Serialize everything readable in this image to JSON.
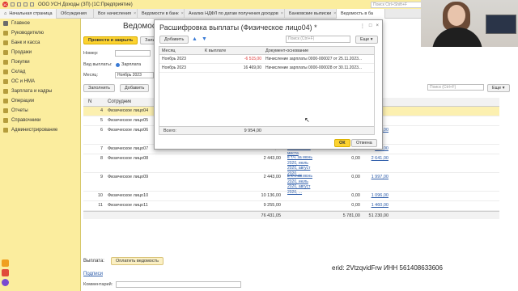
{
  "app": {
    "title": "ООО УСН Доходы (ЗП)  (1С:Предприятие)",
    "search_placeholder": "Поиск Ctrl+Shift+F"
  },
  "tabs": [
    {
      "label": "Начальная страница"
    },
    {
      "label": "Обсуждения"
    },
    {
      "label": "Все начисления"
    },
    {
      "label": "Ведомости в банк"
    },
    {
      "label": "Анализ НДФЛ по датам получения доходов"
    },
    {
      "label": "Банковские выписки"
    },
    {
      "label": "Ведомость в ба"
    }
  ],
  "sidebar": [
    {
      "label": "Главное"
    },
    {
      "label": "Руководителю"
    },
    {
      "label": "Банк и касса"
    },
    {
      "label": "Продажи"
    },
    {
      "label": "Покупки"
    },
    {
      "label": "Склад"
    },
    {
      "label": "ОС и НМА"
    },
    {
      "label": "Зарплата и кадры"
    },
    {
      "label": "Операции"
    },
    {
      "label": "Отчеты"
    },
    {
      "label": "Справочники"
    },
    {
      "label": "Администрирование"
    }
  ],
  "document": {
    "title": "Ведомость",
    "post_close_label": "Провести и закрыть",
    "record_label": "Записать",
    "number_label": "Номер:",
    "payout_type_label": "Вид выплаты:",
    "payout_type_value": "Зарплата",
    "month_label": "Месяц:",
    "month_value": "Ноябрь 2023",
    "fill_label": "Заполнить",
    "add_label": "Добавить",
    "search_placeholder": "Поиск (Ctrl+F)",
    "more_label": "Еще"
  },
  "main_table": {
    "headers": {
      "n": "N",
      "employee": "Сотрудник"
    },
    "rows": [
      {
        "n": "4",
        "name": "Физическое лицо04",
        "amount": "",
        "period": "",
        "v1": "",
        "v2": "",
        "selected": true
      },
      {
        "n": "5",
        "name": "Физическое лицо05",
        "amount": "",
        "period": "",
        "v1": "",
        "v2": ""
      },
      {
        "n": "6",
        "name": "Физическое лицо06",
        "amount": "14 646,00",
        "period": "в т.ч. за февраль 2019, март 2019, апрель 2019, ...",
        "v1": "",
        "v2": "30 557,00"
      },
      {
        "n": "7",
        "name": "Физическое лицо07",
        "amount": "5 062,00",
        "period": "два рабочих места",
        "v1": "0,00",
        "v2": "338,00"
      },
      {
        "n": "8",
        "name": "Физическое лицо08",
        "amount": "2 443,00",
        "period": "в т.ч. за июнь 2020, июль 2020, август 2020, ...",
        "v1": "0,00",
        "v2": "2 641,00"
      },
      {
        "n": "9",
        "name": "Физическое лицо09",
        "amount": "2 443,00",
        "period": "в т.ч. за июнь 2020, июль 2020, август 2020, ...",
        "v1": "0,00",
        "v2": "1 997,00"
      },
      {
        "n": "10",
        "name": "Физическое лицо10",
        "amount": "10 136,00",
        "period": "",
        "v1": "0,00",
        "v2": "1 096,00"
      },
      {
        "n": "11",
        "name": "Физическое лицо11",
        "amount": "9 255,00",
        "period": "",
        "v1": "0,00",
        "v2": "1 460,00"
      }
    ],
    "totals": {
      "amount": "76 431,05",
      "v1": "5 781,00",
      "v2": "51 230,00"
    }
  },
  "payout": {
    "label": "Выплата:",
    "button_label": "Оплатить ведомость"
  },
  "signatures_label": "Подписи",
  "comment_label": "Комментарий:",
  "dialog": {
    "title": "Расшифровка выплаты (Физическое лицо04) *",
    "add_label": "Добавить",
    "up_icon": "▲",
    "down_icon": "▼",
    "search_placeholder": "Поиск (Ctrl+F)",
    "more_label": "Еще",
    "headers": {
      "month": "Месяц",
      "amount": "К выплате",
      "doc": "Документ-основание"
    },
    "rows": [
      {
        "month": "Ноябрь 2023",
        "amount": "-6 515,00",
        "doc": "Начисление зарплаты 0000-000027 от 25.11.2023...",
        "negative": true
      },
      {
        "month": "Ноябрь 2023",
        "amount": "16 469,00",
        "doc": "Начисление зарплаты 0000-000028 от 30.11.2023...",
        "negative": false
      }
    ],
    "total_label": "Всего:",
    "total_value": "9 954,00",
    "ok_label": "ОК",
    "cancel_label": "Отмена"
  },
  "erid_text": "erid: 2VtzqvidFrw ИНН 561408633606",
  "colors": {
    "accent": "#fcd22f",
    "sidebar": "#fbed9e",
    "link": "#2a5aa8",
    "negative": "#d33333"
  }
}
